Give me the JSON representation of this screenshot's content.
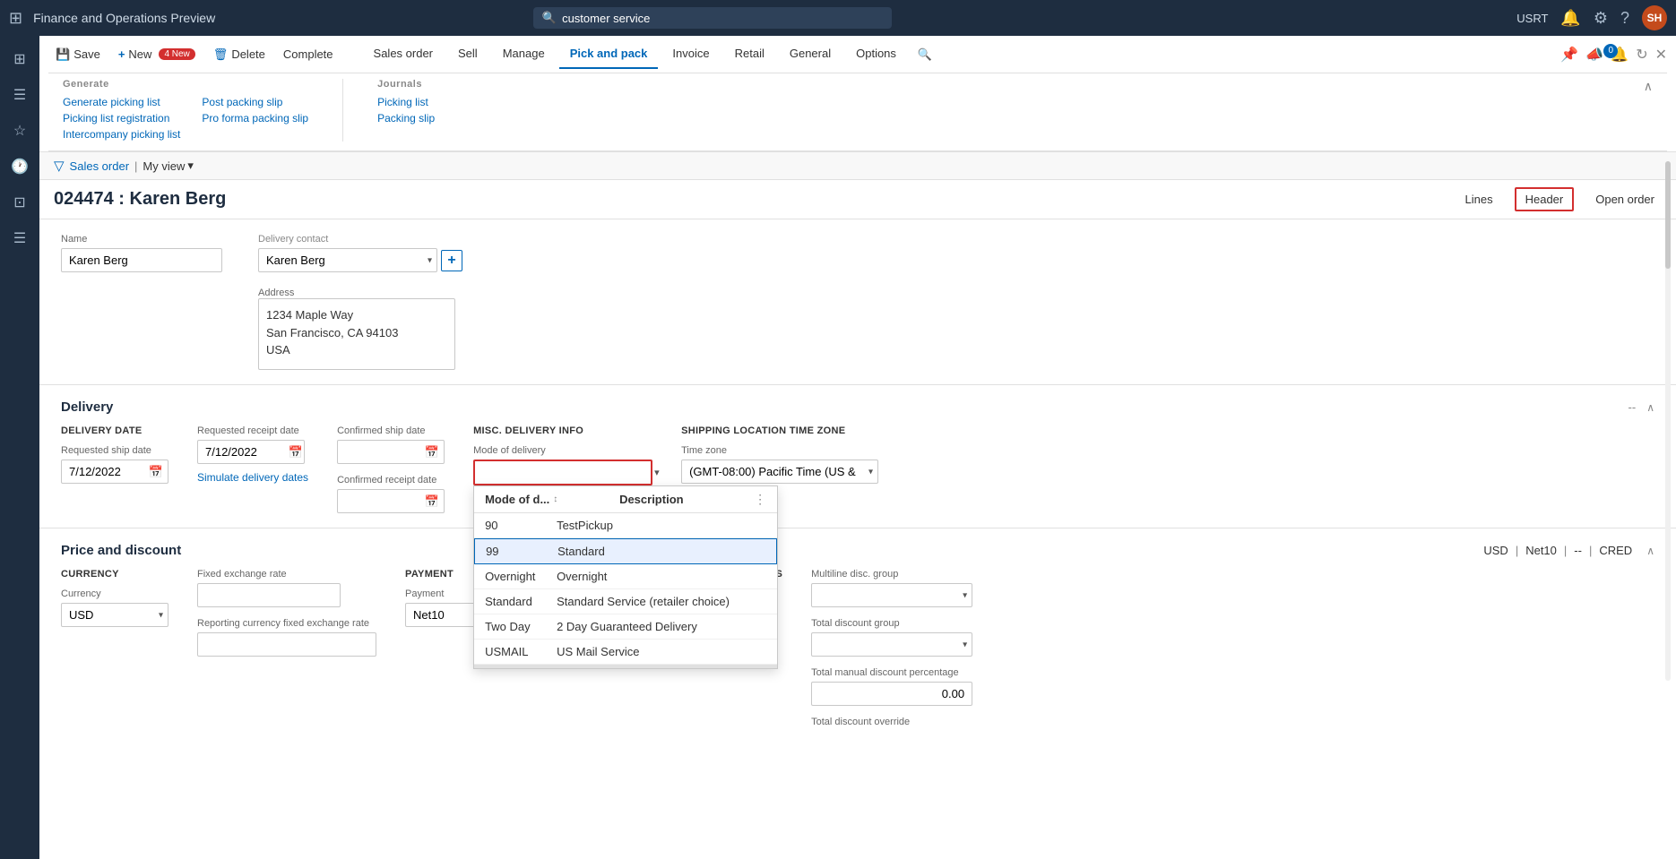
{
  "app": {
    "title": "Finance and Operations Preview",
    "user": "USRT",
    "avatar": "SH"
  },
  "search": {
    "placeholder": "customer service",
    "value": "customer service"
  },
  "topnav": {
    "icons": [
      "🔔",
      "⚙",
      "?"
    ]
  },
  "ribbon": {
    "save_label": "Save",
    "new_label": "New",
    "new_badge": "4 New",
    "delete_label": "Delete",
    "complete_label": "Complete",
    "sales_order_label": "Sales order",
    "sell_label": "Sell",
    "manage_label": "Manage",
    "pick_and_pack_label": "Pick and pack",
    "invoice_label": "Invoice",
    "retail_label": "Retail",
    "general_label": "General",
    "options_label": "Options",
    "generate_group": "Generate",
    "journals_group": "Journals",
    "generate_items": [
      "Generate picking list",
      "Picking list registration",
      "Intercompany picking list"
    ],
    "generate_items_col2": [
      "Post packing slip",
      "Pro forma packing slip"
    ],
    "journals_items": [
      "Picking list",
      "Packing slip"
    ]
  },
  "viewbar": {
    "breadcrumb": "Sales order",
    "separator": "|",
    "view_label": "My view",
    "filter_icon": "▼"
  },
  "page": {
    "title": "024474 : Karen Berg",
    "lines_btn": "Lines",
    "header_btn": "Header",
    "open_order_btn": "Open order"
  },
  "customer": {
    "name_label": "Name",
    "name_value": "Karen Berg",
    "dropdown_label": "Karen Berg",
    "address_label": "Address",
    "address_lines": [
      "1234 Maple Way",
      "San Francisco, CA 94103",
      "USA"
    ]
  },
  "delivery": {
    "section_title": "Delivery",
    "delivery_date_label": "DELIVERY DATE",
    "requested_ship_label": "Requested ship date",
    "requested_ship_value": "7/12/2022",
    "requested_receipt_label": "Requested receipt date",
    "requested_receipt_value": "7/12/2022",
    "simulate_link": "Simulate delivery dates",
    "confirmed_ship_label": "Confirmed ship date",
    "confirmed_ship_value": "",
    "confirmed_receipt_label": "Confirmed receipt date",
    "confirmed_receipt_value": "",
    "misc_label": "MISC. DELIVERY INFO",
    "mode_of_delivery_label": "Mode of delivery",
    "mode_of_delivery_value": "",
    "shipping_tz_label": "SHIPPING LOCATION TIME ZONE",
    "time_zone_label": "Time zone",
    "time_zone_value": "(GMT-08:00) Pacific Time (US & ...",
    "dropdown_options": [
      {
        "code": "90",
        "desc": "TestPickup",
        "selected": false
      },
      {
        "code": "99",
        "desc": "Standard",
        "selected": true
      },
      {
        "code": "Overnight",
        "desc": "Overnight",
        "selected": false
      },
      {
        "code": "Standard",
        "desc": "Standard Service (retailer choice)",
        "selected": false
      },
      {
        "code": "Two Day",
        "desc": "2 Day Guaranteed Delivery",
        "selected": false
      },
      {
        "code": "USMAIL",
        "desc": "US Mail Service",
        "selected": false
      }
    ],
    "dropdown_col1": "Mode of d...",
    "dropdown_col2": "Description"
  },
  "price_discount": {
    "section_title": "Price and discount",
    "currency_label": "CURRENCY",
    "currency_field_label": "Currency",
    "currency_value": "USD",
    "fixed_rate_label": "Fixed exchange rate",
    "reporting_rate_label": "Reporting currency fixed exchange rate",
    "payment_label": "PAYMENT",
    "payment_field_label": "Payment",
    "payment_value": "Net10",
    "tags": [
      "USD",
      "Net10",
      "--",
      "CRED"
    ],
    "charges_label": "CHARGES",
    "multiline_disc_label": "Multiline disc. group",
    "total_disc_label": "Total discount group",
    "total_manual_label": "Total manual discount percentage",
    "total_manual_value": "0.00",
    "total_override_label": "Total discount override"
  }
}
